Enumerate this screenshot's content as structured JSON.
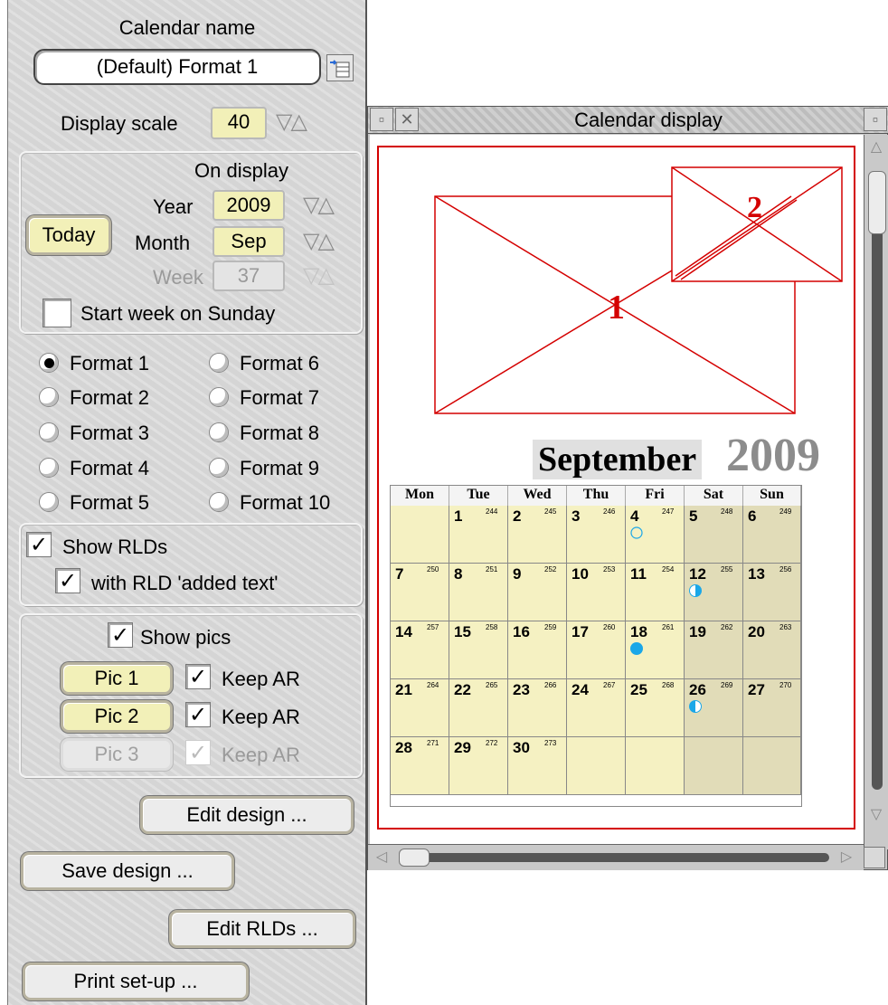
{
  "panel": {
    "calendar_name_label": "Calendar name",
    "calendar_name_value": "(Default) Format 1",
    "display_scale_label": "Display scale",
    "display_scale_value": "40",
    "on_display_label": "On display",
    "year_label": "Year",
    "year_value": "2009",
    "month_label": "Month",
    "month_value": "Sep",
    "week_label": "Week",
    "week_value": "37",
    "today_button": "Today",
    "start_week_sunday_label": "Start week on Sunday",
    "formats": [
      "Format 1",
      "Format 2",
      "Format 3",
      "Format 4",
      "Format 5",
      "Format 6",
      "Format 7",
      "Format 8",
      "Format 9",
      "Format 10"
    ],
    "selected_format": "Format 1",
    "show_rlds_label": "Show RLDs",
    "with_rld_added_text_label": "with RLD 'added text'",
    "show_pics_label": "Show pics",
    "pic_buttons": [
      "Pic 1",
      "Pic 2",
      "Pic 3"
    ],
    "keep_ar_label": "Keep AR",
    "edit_design_button": "Edit design ...",
    "save_design_button": "Save design ...",
    "edit_rlds_button": "Edit RLDs ...",
    "print_setup_button": "Print set-up ..."
  },
  "window": {
    "title": "Calendar display",
    "month_title": "September",
    "year_title": "2009",
    "picture_labels": [
      "1",
      "2"
    ],
    "weekday_headers": [
      "Mon",
      "Tue",
      "Wed",
      "Thu",
      "Fri",
      "Sat",
      "Sun"
    ],
    "weeks": [
      [
        null,
        {
          "day": "1",
          "yday": "244"
        },
        {
          "day": "2",
          "yday": "245"
        },
        {
          "day": "3",
          "yday": "246"
        },
        {
          "day": "4",
          "yday": "247",
          "moon": "new"
        },
        {
          "day": "5",
          "yday": "248"
        },
        {
          "day": "6",
          "yday": "249"
        }
      ],
      [
        {
          "day": "7",
          "yday": "250"
        },
        {
          "day": "8",
          "yday": "251"
        },
        {
          "day": "9",
          "yday": "252"
        },
        {
          "day": "10",
          "yday": "253"
        },
        {
          "day": "11",
          "yday": "254"
        },
        {
          "day": "12",
          "yday": "255",
          "moon": "first-quarter"
        },
        {
          "day": "13",
          "yday": "256"
        }
      ],
      [
        {
          "day": "14",
          "yday": "257"
        },
        {
          "day": "15",
          "yday": "258"
        },
        {
          "day": "16",
          "yday": "259"
        },
        {
          "day": "17",
          "yday": "260"
        },
        {
          "day": "18",
          "yday": "261",
          "moon": "full"
        },
        {
          "day": "19",
          "yday": "262"
        },
        {
          "day": "20",
          "yday": "263"
        }
      ],
      [
        {
          "day": "21",
          "yday": "264"
        },
        {
          "day": "22",
          "yday": "265"
        },
        {
          "day": "23",
          "yday": "266"
        },
        {
          "day": "24",
          "yday": "267"
        },
        {
          "day": "25",
          "yday": "268"
        },
        {
          "day": "26",
          "yday": "269",
          "moon": "last-quarter"
        },
        {
          "day": "27",
          "yday": "270"
        }
      ],
      [
        {
          "day": "28",
          "yday": "271"
        },
        {
          "day": "29",
          "yday": "272"
        },
        {
          "day": "30",
          "yday": "273"
        },
        null,
        null,
        null,
        null
      ]
    ],
    "colors": {
      "frame_red": "#d40000",
      "weekday_cell": "#f5f1c2",
      "weekend_cell": "#e1dcb8",
      "moon_blue": "#1aa7e8",
      "year_gray": "#8c8c8c"
    }
  }
}
